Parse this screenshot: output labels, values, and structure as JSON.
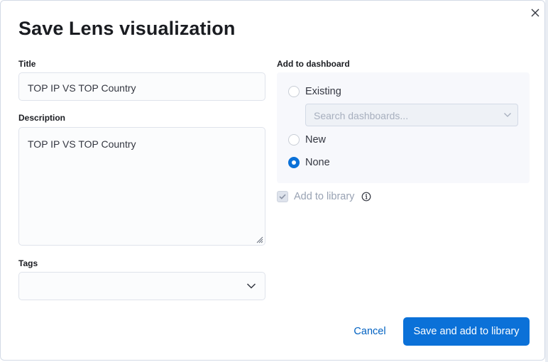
{
  "modal": {
    "title": "Save Lens visualization",
    "close_icon": "close-icon"
  },
  "form": {
    "title_label": "Title",
    "title_value": "TOP IP VS TOP Country",
    "description_label": "Description",
    "description_value": "TOP IP VS TOP Country",
    "tags_label": "Tags",
    "tags_value": ""
  },
  "dashboard": {
    "label": "Add to dashboard",
    "options": [
      {
        "label": "Existing",
        "selected": false
      },
      {
        "label": "New",
        "selected": false
      },
      {
        "label": "None",
        "selected": true
      }
    ],
    "search_placeholder": "Search dashboards..."
  },
  "library": {
    "label": "Add to library",
    "checked": true,
    "disabled": true,
    "info_icon": "info-icon"
  },
  "actions": {
    "cancel_label": "Cancel",
    "save_label": "Save and add to library"
  },
  "colors": {
    "primary": "#0b71d8",
    "link": "#0061c2",
    "panel_bg": "#f7f8fc"
  }
}
